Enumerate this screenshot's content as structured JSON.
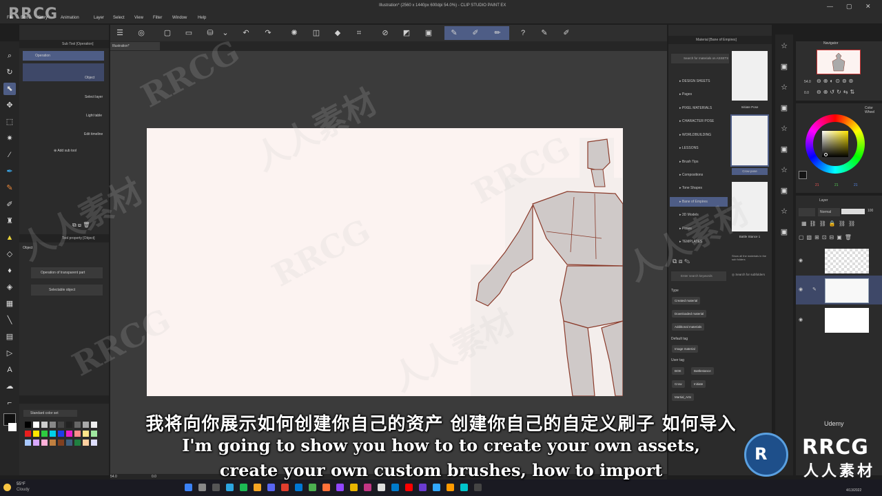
{
  "window": {
    "title": "Illustration* (2560 x 1440px 600dpi 54.0%) - CLIP STUDIO PAINT EX",
    "controls": [
      "—",
      "▢",
      "✕"
    ]
  },
  "menu": [
    "File",
    "Edit",
    "Story",
    "Animation",
    "Layer",
    "Select",
    "View",
    "Filter",
    "Window",
    "Help"
  ],
  "document": {
    "tab_label": "Illustration*"
  },
  "subtool_panel": {
    "header": "Sub Tool [Operation]",
    "items": [
      "Operation",
      "Object",
      "Select layer",
      "Light table",
      "Edit timeline"
    ],
    "add_label": "Add sub tool"
  },
  "tool_property": {
    "header": "Tool property [Object]",
    "title": "Object",
    "dropdowns": [
      "Operation of transparent part",
      "Selectable object"
    ]
  },
  "color_set": {
    "label": "Standard color set"
  },
  "material_panel": {
    "header": "Material [Bane of Empires]",
    "search_placeholder": "Search for materials on ASSETS",
    "folders": [
      "DESIGN SHEETS",
      "Pages",
      "PIXEL MATERIALS",
      "CHARACTER POSE",
      "WORLDBUILDING",
      "LESSONS",
      "Brush Tips",
      "Compositions",
      "Tone Shapes",
      "Bane of Empires",
      "3D Models",
      "Poses",
      "TEMPLATES"
    ],
    "thumbnails": [
      "Initiate Pose",
      "Crow pose",
      "Battle Stance 1"
    ],
    "show_all": "Show all the materials in the sub folders",
    "keyword_placeholder": "Enter search keywords",
    "search_subfolders": "Search for subfolders",
    "type_label": "Type",
    "type_tags": [
      "Created material",
      "Downloaded material",
      "Additional materials"
    ],
    "default_tag_label": "Default tag",
    "default_tags": [
      "Image material"
    ],
    "user_tag_label": "User tag",
    "user_tags": [
      "BOE",
      "Battlestance",
      "Crow",
      "Initiate",
      "Martial_Arts"
    ]
  },
  "navigator": {
    "header": "Navigator",
    "zoom": "54.0",
    "angle": "0.0"
  },
  "color_wheel": {
    "header": "Color Wheel",
    "values": [
      "21",
      "21",
      "21"
    ]
  },
  "layer_panel": {
    "header": "Layer",
    "blend_mode": "Normal",
    "opacity": "100"
  },
  "status": {
    "zoom": "54.0",
    "frame": "0.0"
  },
  "taskbar": {
    "weather_temp": "55°F",
    "weather_desc": "Cloudy",
    "time": "",
    "date": "4/13/2022"
  },
  "subtitles": {
    "zh": "我将向你展示如何创建你自己的资产 创建你自己的自定义刷子 如何导入",
    "en_line1": "I'm going to show you how to to create your own assets,",
    "en_line2": "create your own custom brushes, how to import"
  },
  "branding": {
    "logo": "RRCG",
    "watermark_en": "RRCG",
    "watermark_cn": "人人素材",
    "brand_name": "RRCG",
    "brand_cn": "人人素材",
    "udemy": "Udemy"
  },
  "colors": {
    "accent": "#4e5d86",
    "canvas_paper": "#fcf3f1",
    "sketch_line": "#8a3a2a"
  }
}
